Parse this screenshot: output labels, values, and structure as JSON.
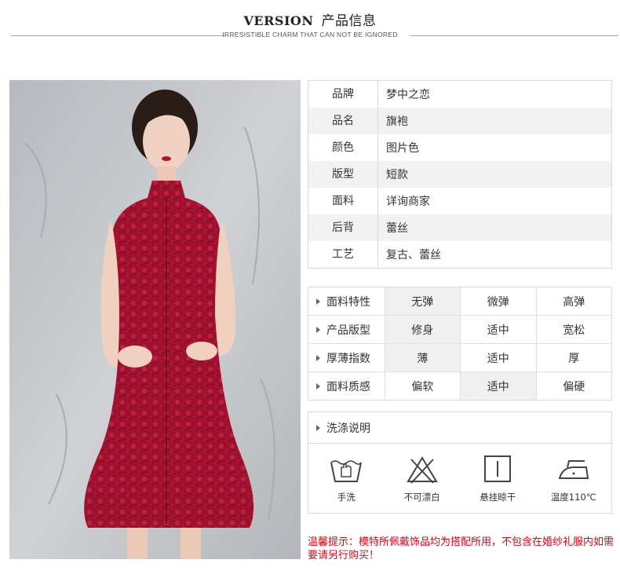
{
  "header": {
    "title_en": "VERSION",
    "title_cn": "产品信息",
    "subtitle": "IRRESISTIBLE CHARM THAT CAN NOT BE IGNORED"
  },
  "info_rows": [
    {
      "key": "品牌",
      "value": "梦中之恋"
    },
    {
      "key": "品名",
      "value": "旗袍"
    },
    {
      "key": "颜色",
      "value": "图片色"
    },
    {
      "key": "版型",
      "value": "短款"
    },
    {
      "key": "面料",
      "value": "详询商家"
    },
    {
      "key": "后背",
      "value": "蕾丝"
    },
    {
      "key": "工艺",
      "value": "复古、蕾丝"
    }
  ],
  "features": [
    {
      "label": "面料特性",
      "options": [
        "无弹",
        "微弹",
        "高弹"
      ],
      "selected": 0
    },
    {
      "label": "产品版型",
      "options": [
        "修身",
        "适中",
        "宽松"
      ],
      "selected": 0
    },
    {
      "label": "厚薄指数",
      "options": [
        "薄",
        "适中",
        "厚"
      ],
      "selected": 0
    },
    {
      "label": "面料质感",
      "options": [
        "偏软",
        "适中",
        "偏硬"
      ],
      "selected": 1
    }
  ],
  "wash": {
    "title": "洗涤说明",
    "items": [
      {
        "icon": "hand-wash-icon",
        "label": "手洗"
      },
      {
        "icon": "no-bleach-icon",
        "label": "不可漂白"
      },
      {
        "icon": "hang-dry-icon",
        "label": "悬挂晾干"
      },
      {
        "icon": "iron-icon",
        "label": "温度110℃"
      }
    ]
  },
  "notice": "温馨提示：模特所佩戴饰品均为搭配所用，不包含在婚纱礼服内如需要请另行购买！",
  "colors": {
    "notice": "#e60012",
    "dress": "#a3122f"
  }
}
